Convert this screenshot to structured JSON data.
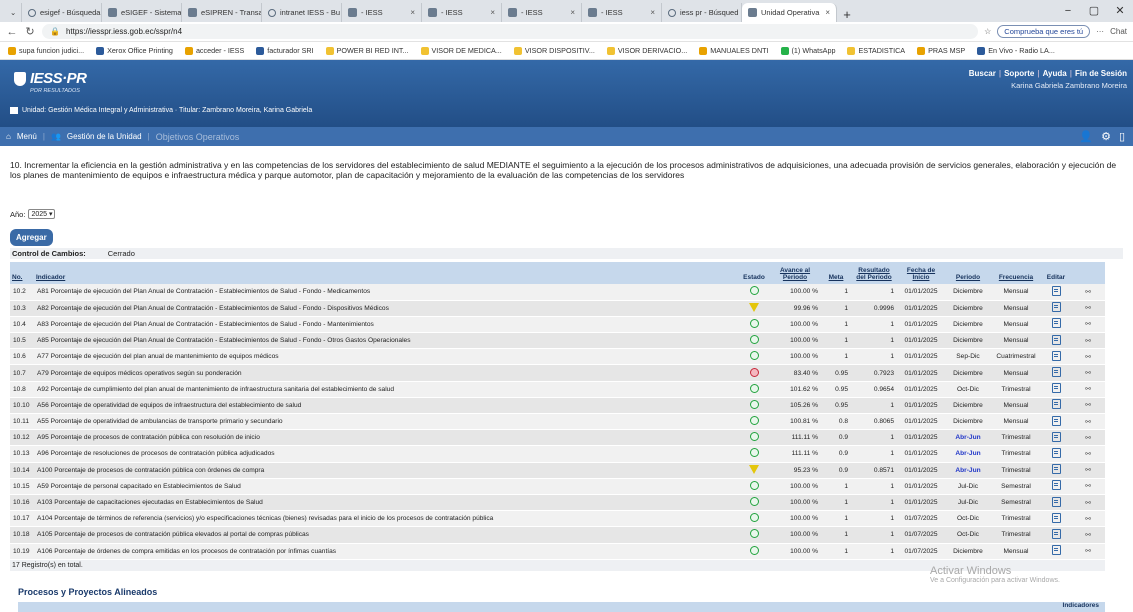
{
  "browser": {
    "tabs": [
      {
        "label": "esigef - Búsqueda",
        "icon": "search-icon"
      },
      {
        "label": "eSIGEF - Sistema",
        "icon": "globe-icon"
      },
      {
        "label": "eSIPREN - Transac",
        "icon": "globe-icon"
      },
      {
        "label": "intranet IESS - Bu",
        "icon": "search-icon"
      },
      {
        "label": "- IESS",
        "icon": "iess-icon"
      },
      {
        "label": "- IESS",
        "icon": "iess-icon"
      },
      {
        "label": "- IESS",
        "icon": "iess-icon"
      },
      {
        "label": "- IESS",
        "icon": "iess-icon"
      },
      {
        "label": "iess pr - Búsqued",
        "icon": "search-icon"
      },
      {
        "label": "Unidad Operativa",
        "icon": "app-icon",
        "active": true
      }
    ],
    "url": "https://iesspr.iess.gob.ec/sspr/n4",
    "compruebe": "Comprueba que eres tú",
    "chat": "Chat",
    "bookmarks": [
      "supa funcion judici...",
      "Xerox Office Printing",
      "acceder - IESS",
      "facturador SRI",
      "POWER BI RED INT...",
      "VISOR DE MEDICA...",
      "VISOR DISPOSITIV...",
      "VISOR DERIVACIO...",
      "MANUALES DNTI",
      "(1) WhatsApp",
      "ESTADISTICA",
      "PRAS MSP",
      "En Vivo - Radio LA..."
    ]
  },
  "header": {
    "logo": "IESS·PR",
    "logo_sub": "POR RESULTADOS",
    "links": [
      "Buscar",
      "Soporte",
      "Ayuda",
      "Fin de Sesión"
    ],
    "user": "Karina Gabriela Zambrano Moreira",
    "unit": "Unidad: Gestión Médica Integral y Administrativa · Titular: Zambrano Moreira, Karina Gabriela"
  },
  "menu": {
    "items": [
      "Menú",
      "Gestión de la Unidad"
    ],
    "current": "Objetivos Operativos"
  },
  "objective": "10. Incrementar la eficiencia en la gestión administrativa y en las competencias de los servidores del establecimiento de salud MEDIANTE el seguimiento a la ejecución de los procesos administrativos de adquisiciones, una adecuada provisión de servicios generales, elaboración y ejecución de los planes de mantenimiento de equipos e infraestructura médica y parque automotor, plan de capacitación y mejoramiento de la evaluación de las competencias de los servidores",
  "filters": {
    "year_label": "Año:",
    "year_value": "2025"
  },
  "add_button": "Agregar",
  "control": {
    "label": "Control de Cambios:",
    "value": "Cerrado"
  },
  "table": {
    "headers": {
      "no": "No.",
      "indicador": "Indicador",
      "estado": "Estado",
      "avance": "Avance al Periodo",
      "meta": "Meta",
      "resultado": "Resultado del Periodo",
      "fecha": "Fecha de Inicio",
      "periodo": "Periodo",
      "frecuencia": "Frecuencia",
      "editar": "Editar"
    },
    "rows": [
      {
        "no": "10.2",
        "ind": "A81 Porcentaje de ejecución del Plan Anual de Contratación - Establecimientos de Salud - Fondo - Medicamentos",
        "estado": "green",
        "avance": "100.00 %",
        "meta": "1",
        "res": "1",
        "fecha": "01/01/2025",
        "periodo": "Diciembre",
        "freq": "Mensual"
      },
      {
        "no": "10.3",
        "ind": "A82 Porcentaje de ejecución del Plan Anual de Contratación - Establecimientos de Salud - Fondo - Dispositivos Médicos",
        "estado": "yellow",
        "avance": "99.96 %",
        "meta": "1",
        "res": "0.9996",
        "fecha": "01/01/2025",
        "periodo": "Diciembre",
        "freq": "Mensual"
      },
      {
        "no": "10.4",
        "ind": "A83 Porcentaje de ejecución del Plan Anual de Contratación - Establecimientos de Salud - Fondo - Mantenimientos",
        "estado": "green",
        "avance": "100.00 %",
        "meta": "1",
        "res": "1",
        "fecha": "01/01/2025",
        "periodo": "Diciembre",
        "freq": "Mensual"
      },
      {
        "no": "10.5",
        "ind": "A85 Porcentaje de ejecución del Plan Anual de Contratación - Establecimientos de Salud - Fondo - Otros Gastos Operacionales",
        "estado": "green",
        "avance": "100.00 %",
        "meta": "1",
        "res": "1",
        "fecha": "01/01/2025",
        "periodo": "Diciembre",
        "freq": "Mensual"
      },
      {
        "no": "10.6",
        "ind": "A77 Porcentaje de ejecución del plan anual de mantenimiento de equipos médicos",
        "estado": "green",
        "avance": "100.00 %",
        "meta": "1",
        "res": "1",
        "fecha": "01/01/2025",
        "periodo": "Sep-Dic",
        "freq": "Cuatrimestral"
      },
      {
        "no": "10.7",
        "ind": "A79 Porcentaje de equipos médicos operativos según su ponderación",
        "estado": "red",
        "avance": "83.40 %",
        "meta": "0.95",
        "res": "0.7923",
        "fecha": "01/01/2025",
        "periodo": "Diciembre",
        "freq": "Mensual"
      },
      {
        "no": "10.8",
        "ind": "A92 Porcentaje de cumplimiento del plan anual de mantenimiento de infraestructura sanitaria del establecimiento de salud",
        "estado": "green",
        "avance": "101.62 %",
        "meta": "0.95",
        "res": "0.9654",
        "fecha": "01/01/2025",
        "periodo": "Oct-Dic",
        "freq": "Trimestral"
      },
      {
        "no": "10.10",
        "ind": "A56 Porcentaje de operatividad de equipos de infraestructura del establecimiento de salud",
        "estado": "green",
        "avance": "105.26 %",
        "meta": "0.95",
        "res": "1",
        "fecha": "01/01/2025",
        "periodo": "Diciembre",
        "freq": "Mensual"
      },
      {
        "no": "10.11",
        "ind": "A55 Porcentaje de operatividad de ambulancias de transporte primario y secundario",
        "estado": "green",
        "avance": "100.81 %",
        "meta": "0.8",
        "res": "0.8065",
        "fecha": "01/01/2025",
        "periodo": "Diciembre",
        "freq": "Mensual"
      },
      {
        "no": "10.12",
        "ind": "A95 Porcentaje de procesos de contratación pública con resolución de inicio",
        "estado": "green",
        "avance": "111.11 %",
        "meta": "0.9",
        "res": "1",
        "fecha": "01/01/2025",
        "periodo": "Abr-Jun",
        "periodo_blue": true,
        "freq": "Trimestral"
      },
      {
        "no": "10.13",
        "ind": "A96 Porcentaje de resoluciones de procesos de contratación pública adjudicados",
        "estado": "green",
        "avance": "111.11 %",
        "meta": "0.9",
        "res": "1",
        "fecha": "01/01/2025",
        "periodo": "Abr-Jun",
        "periodo_blue": true,
        "freq": "Trimestral"
      },
      {
        "no": "10.14",
        "ind": "A100 Porcentaje de procesos de contratación pública con órdenes de compra",
        "estado": "yellow",
        "avance": "95.23 %",
        "meta": "0.9",
        "res": "0.8571",
        "fecha": "01/01/2025",
        "periodo": "Abr-Jun",
        "periodo_blue": true,
        "freq": "Trimestral"
      },
      {
        "no": "10.15",
        "ind": "A59 Porcentaje de personal capacitado en Establecimientos de Salud",
        "estado": "green",
        "avance": "100.00 %",
        "meta": "1",
        "res": "1",
        "fecha": "01/01/2025",
        "periodo": "Jul-Dic",
        "freq": "Semestral"
      },
      {
        "no": "10.16",
        "ind": "A103 Porcentaje de capacitaciones ejecutadas en Establecimientos de Salud",
        "estado": "green",
        "avance": "100.00 %",
        "meta": "1",
        "res": "1",
        "fecha": "01/01/2025",
        "periodo": "Jul-Dic",
        "freq": "Semestral"
      },
      {
        "no": "10.17",
        "ind": "A104 Porcentaje de términos de referencia (servicios) y/o especificaciones técnicas (bienes) revisadas para el inicio de los procesos de contratación pública",
        "estado": "green",
        "avance": "100.00 %",
        "meta": "1",
        "res": "1",
        "fecha": "01/07/2025",
        "periodo": "Oct-Dic",
        "freq": "Trimestral"
      },
      {
        "no": "10.18",
        "ind": "A105 Porcentaje de procesos de contratación pública elevados al portal de compras públicas",
        "estado": "green",
        "avance": "100.00 %",
        "meta": "1",
        "res": "1",
        "fecha": "01/07/2025",
        "periodo": "Oct-Dic",
        "freq": "Trimestral"
      },
      {
        "no": "10.19",
        "ind": "A106 Porcentaje de órdenes de compra emitidas en los procesos de contratación por ínfimas cuantías",
        "estado": "green",
        "avance": "100.00 %",
        "meta": "1",
        "res": "1",
        "fecha": "01/07/2025",
        "periodo": "Diciembre",
        "freq": "Mensual"
      }
    ],
    "footer": "17 Registro(s) en total."
  },
  "watermark": {
    "line1": "Activar Windows",
    "line2": "Ve a Configuración para activar Windows."
  },
  "section2": {
    "title": "Procesos y Proyectos Alineados",
    "col": "Indicadores"
  }
}
